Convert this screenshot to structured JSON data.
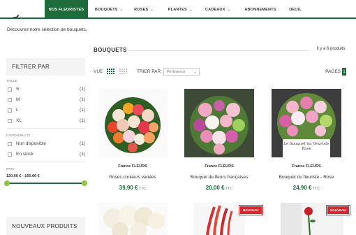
{
  "nav": {
    "items": [
      {
        "label": "NOS FLEURISTES",
        "active": true,
        "caret": false
      },
      {
        "label": "BOUQUETS",
        "active": false,
        "caret": true
      },
      {
        "label": "ROSES",
        "active": false,
        "caret": true
      },
      {
        "label": "PLANTES",
        "active": false,
        "caret": true
      },
      {
        "label": "CADEAUX",
        "active": false,
        "caret": true
      },
      {
        "label": "ABONNEMENTS",
        "active": false,
        "caret": false
      },
      {
        "label": "DEUIL",
        "active": false,
        "caret": false
      }
    ],
    "caret_glyph": "⌄"
  },
  "intro_text": "Découvrez notre sélection de bouquets.",
  "sidebar": {
    "filter_title": "FILTRER PAR",
    "size_facet": {
      "title": "TAILLE",
      "options": [
        {
          "label": "S",
          "count": "(1)"
        },
        {
          "label": "M",
          "count": "(1)"
        },
        {
          "label": "L",
          "count": "(1)"
        },
        {
          "label": "XL",
          "count": "(1)"
        }
      ]
    },
    "availability_facet": {
      "title": "DISPONIBILITÉ",
      "options": [
        {
          "label": "Non disponible",
          "count": "(1)"
        },
        {
          "label": "En stock",
          "count": "(1)"
        }
      ]
    },
    "price_facet": {
      "title": "PRIX",
      "range": "120.00 € - 160.00 €"
    },
    "new_products_title": "NOUVEAUX PRODUITS"
  },
  "main": {
    "section_title": "BOUQUETS",
    "count_text": "Il y a 6 produits.",
    "view_label": "VUE",
    "sort_label": "TRIER PAR",
    "sort_value": "Pertinence",
    "pages_label": "PAGES",
    "current_page": "1"
  },
  "products": [
    {
      "brand": "France FLEURS",
      "name": "Roses couleurs variées",
      "price": "39,90 €",
      "ttc": "TTC"
    },
    {
      "brand": "France FLEURS",
      "name": "Bouquet de fleurs françaises",
      "price": "20,00 €",
      "ttc": "TTC"
    },
    {
      "brand": "France FLEURS",
      "name": "Bouquet du fleuriste - Rose",
      "price": "24,90 €",
      "ttc": "TTC",
      "card_text": "Le bouquet du fleuriste Rose"
    }
  ],
  "badges": {
    "new_label": "NOUVEAU"
  },
  "colors": {
    "brand_green": "#1d6b3a",
    "slider_handle": "#8dc63f",
    "badge_red": "#d7282f"
  }
}
